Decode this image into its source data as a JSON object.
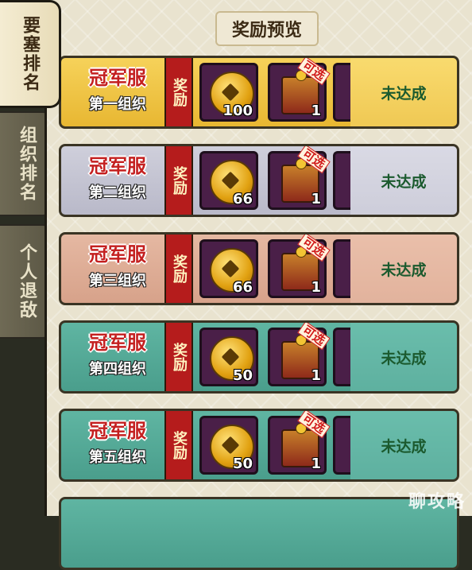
{
  "tabs": [
    {
      "label": "要塞排名",
      "active": true
    },
    {
      "label": "组织排名",
      "active": false
    },
    {
      "label": "个人退敌",
      "active": false
    }
  ],
  "title": "奖励预览",
  "reward_tag": "奖励",
  "select_tag": "可选",
  "rows": [
    {
      "champion": "冠军服",
      "group": "第一组织",
      "coin_qty": "100",
      "chest_qty": "1",
      "status": "未达成",
      "tier": "gold"
    },
    {
      "champion": "冠军服",
      "group": "第二组织",
      "coin_qty": "66",
      "chest_qty": "1",
      "status": "未达成",
      "tier": "silver"
    },
    {
      "champion": "冠军服",
      "group": "第三组织",
      "coin_qty": "66",
      "chest_qty": "1",
      "status": "未达成",
      "tier": "bronze"
    },
    {
      "champion": "冠军服",
      "group": "第四组织",
      "coin_qty": "50",
      "chest_qty": "1",
      "status": "未达成",
      "tier": "teal"
    },
    {
      "champion": "冠军服",
      "group": "第五组织",
      "coin_qty": "50",
      "chest_qty": "1",
      "status": "未达成",
      "tier": "teal"
    }
  ],
  "watermark": "聊攻略",
  "icons": [
    "coin-icon",
    "chest-icon"
  ]
}
